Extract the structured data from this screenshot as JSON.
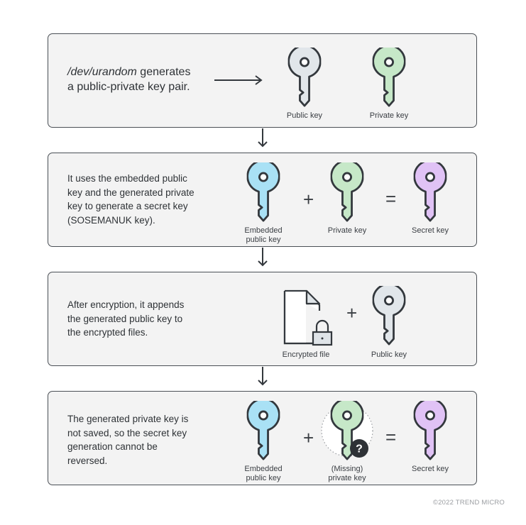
{
  "steps": [
    {
      "text_italic": "/dev/urandom",
      "text_line1_rest": " generates",
      "text_line2": "a public-private key pair.",
      "items": [
        {
          "icon": "key-icon",
          "label": "Public key",
          "color": "#e1e6ea"
        },
        {
          "icon": "key-icon",
          "label": "Private key",
          "color": "#c6e8c8"
        }
      ]
    },
    {
      "text_lines": [
        "It uses the embedded public",
        "key and the generated private",
        "key to generate a secret key",
        "(SOSEMANUK key)."
      ],
      "items": [
        {
          "icon": "key-icon",
          "label_lines": [
            "Embedded",
            "public key"
          ],
          "color": "#a9e1f5"
        },
        {
          "icon": "key-icon",
          "label": "Private key",
          "color": "#c6e8c8"
        },
        {
          "icon": "key-icon",
          "label": "Secret key",
          "color": "#e0c2f5"
        }
      ],
      "operators": [
        "+",
        "="
      ]
    },
    {
      "text_lines": [
        "After encryption, it appends",
        "the generated public key to",
        "the encrypted files."
      ],
      "items": [
        {
          "icon": "encrypted-file-icon",
          "label": "Encrypted file"
        },
        {
          "icon": "key-icon",
          "label": "Public key",
          "color": "#e1e6ea"
        }
      ],
      "operators": [
        "+"
      ]
    },
    {
      "text_lines": [
        "The generated private key is",
        "not saved, so the secret key",
        "generation cannot be",
        "reversed."
      ],
      "items": [
        {
          "icon": "key-icon",
          "label_lines": [
            "Embedded",
            "public key"
          ],
          "color": "#a9e1f5"
        },
        {
          "icon": "key-icon",
          "label_lines": [
            "(Missing)",
            "private key"
          ],
          "color": "#c6e8c8",
          "badge": "?"
        },
        {
          "icon": "key-icon",
          "label": "Secret key",
          "color": "#e0c2f5"
        }
      ],
      "operators": [
        "+",
        "="
      ]
    }
  ],
  "colors": {
    "stroke": "#33383d",
    "box_bg": "#f3f3f3",
    "public_key": "#e1e6ea",
    "private_key": "#c6e8c8",
    "embedded_key": "#a9e1f5",
    "secret_key": "#e0c2f5"
  },
  "footer": {
    "copyright": "©2022 TREND MICRO"
  }
}
